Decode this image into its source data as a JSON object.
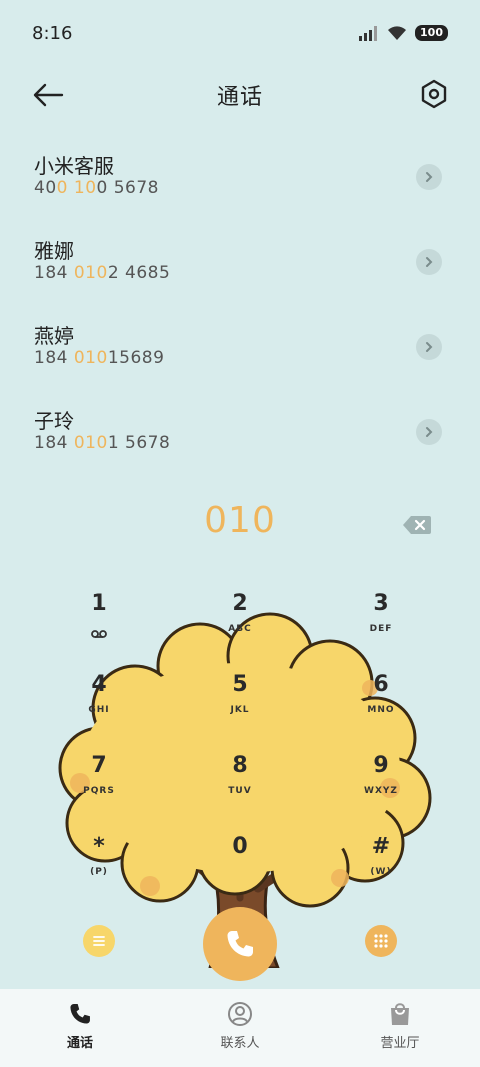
{
  "status_bar": {
    "time": "8:16",
    "battery": "100"
  },
  "header": {
    "title": "通话"
  },
  "contacts": [
    {
      "name": "小米客服",
      "number_parts": [
        "40",
        "0",
        " ",
        "10",
        "0 5678"
      ]
    },
    {
      "name": "雅娜",
      "number_parts": [
        "184 ",
        "010",
        "2 4685"
      ]
    },
    {
      "name": "燕婷",
      "number_parts": [
        "184 ",
        "010",
        "15689"
      ]
    },
    {
      "name": "子玲",
      "number_parts": [
        "184 ",
        "010",
        "1 5678"
      ]
    }
  ],
  "dialed_number": "010",
  "keypad": [
    {
      "digit": "1",
      "letters": ""
    },
    {
      "digit": "2",
      "letters": "ABC"
    },
    {
      "digit": "3",
      "letters": "DEF"
    },
    {
      "digit": "4",
      "letters": "GHI"
    },
    {
      "digit": "5",
      "letters": "JKL"
    },
    {
      "digit": "6",
      "letters": "MNO"
    },
    {
      "digit": "7",
      "letters": "PQRS"
    },
    {
      "digit": "8",
      "letters": "TUV"
    },
    {
      "digit": "9",
      "letters": "WXYZ"
    },
    {
      "digit": "*",
      "letters": "(P)"
    },
    {
      "digit": "0",
      "letters": ""
    },
    {
      "digit": "#",
      "letters": "(W)"
    }
  ],
  "bottom_nav": {
    "calls": "通话",
    "contacts": "联系人",
    "store": "营业厅"
  },
  "colors": {
    "accent": "#efb55c",
    "background": "#d8ecec",
    "tree": "#f7d66a"
  }
}
